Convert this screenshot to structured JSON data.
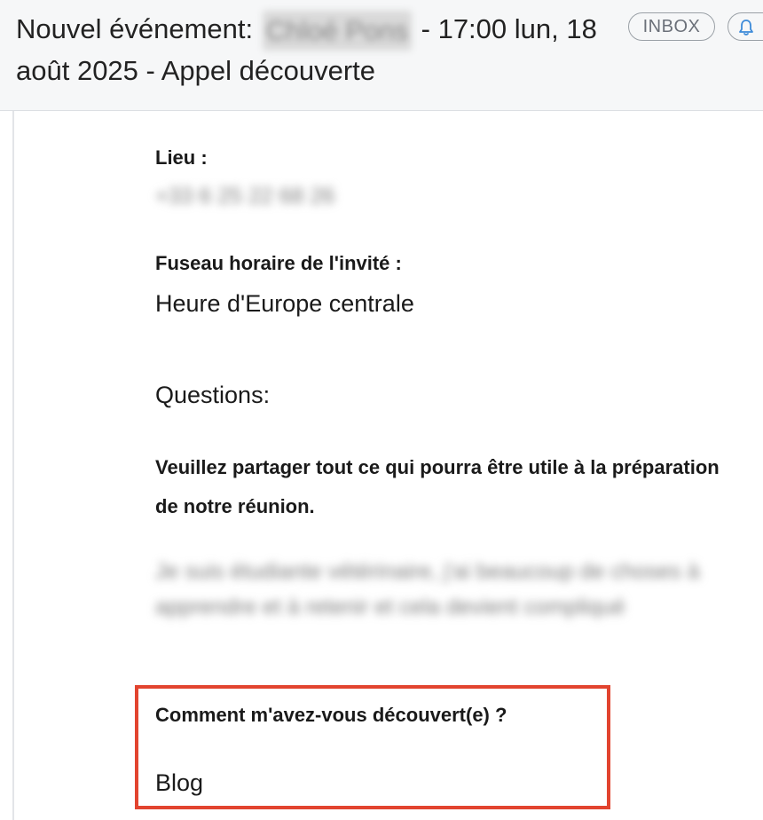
{
  "header": {
    "subject_prefix": "Nouvel événement:",
    "subject_redacted_name": "Chloé Pons",
    "subject_suffix": "- 17:00 lun, 18 août 2025 - Appel découverte",
    "inbox_badge": "INBOX",
    "bell_icon": "bell-icon"
  },
  "body": {
    "location": {
      "label": "Lieu :",
      "value_redacted": "+33 6 25 22 68 26"
    },
    "timezone": {
      "label": "Fuseau horaire de l'invité :",
      "value": "Heure d'Europe centrale"
    },
    "questions_heading": "Questions:",
    "question1": {
      "label": "Veuillez partager tout ce qui pourra être utile à la préparation de notre réunion.",
      "answer_redacted": "Je suis étudiante vétérinaire, j'ai beaucoup de choses à apprendre et à retenir et cela devient compliqué"
    },
    "question2": {
      "label": "Comment m'avez-vous découvert(e) ?",
      "answer": "Blog"
    }
  },
  "colors": {
    "header_bg": "#f6f7f8",
    "highlight_border": "#e2442f",
    "badge_border": "#9aa0a6",
    "bell_icon": "#3d8bd9"
  }
}
